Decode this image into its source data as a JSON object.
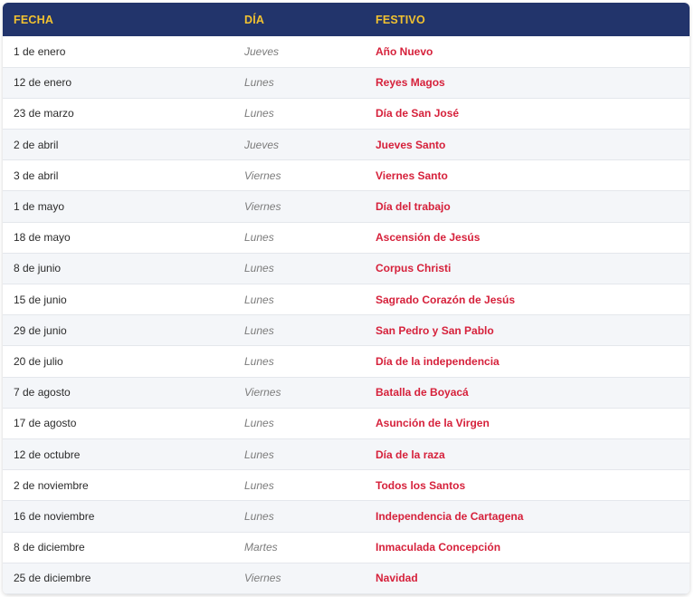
{
  "table": {
    "headers": {
      "fecha": "FECHA",
      "dia": "DÍA",
      "festivo": "FESTIVO"
    },
    "rows": [
      {
        "fecha": "1 de enero",
        "dia": "Jueves",
        "festivo": "Año Nuevo"
      },
      {
        "fecha": "12 de enero",
        "dia": "Lunes",
        "festivo": "Reyes Magos"
      },
      {
        "fecha": "23 de marzo",
        "dia": "Lunes",
        "festivo": "Día de San José"
      },
      {
        "fecha": "2 de abril",
        "dia": "Jueves",
        "festivo": "Jueves Santo"
      },
      {
        "fecha": "3 de abril",
        "dia": "Viernes",
        "festivo": "Viernes Santo"
      },
      {
        "fecha": "1 de mayo",
        "dia": "Viernes",
        "festivo": "Día del trabajo"
      },
      {
        "fecha": "18 de mayo",
        "dia": "Lunes",
        "festivo": "Ascensión de Jesús"
      },
      {
        "fecha": "8 de junio",
        "dia": "Lunes",
        "festivo": "Corpus Christi"
      },
      {
        "fecha": "15 de junio",
        "dia": "Lunes",
        "festivo": "Sagrado Corazón de Jesús"
      },
      {
        "fecha": "29 de junio",
        "dia": "Lunes",
        "festivo": "San Pedro y San Pablo"
      },
      {
        "fecha": "20 de julio",
        "dia": "Lunes",
        "festivo": "Día de la independencia"
      },
      {
        "fecha": "7 de agosto",
        "dia": "Viernes",
        "festivo": "Batalla de Boyacá"
      },
      {
        "fecha": "17 de agosto",
        "dia": "Lunes",
        "festivo": "Asunción de la Virgen"
      },
      {
        "fecha": "12 de octubre",
        "dia": "Lunes",
        "festivo": "Día de la raza"
      },
      {
        "fecha": "2 de noviembre",
        "dia": "Lunes",
        "festivo": "Todos los Santos"
      },
      {
        "fecha": "16 de noviembre",
        "dia": "Lunes",
        "festivo": "Independencia de Cartagena"
      },
      {
        "fecha": "8 de diciembre",
        "dia": "Martes",
        "festivo": "Inmaculada Concepción"
      },
      {
        "fecha": "25 de diciembre",
        "dia": "Viernes",
        "festivo": "Navidad"
      }
    ]
  },
  "colors": {
    "header_bg": "#22346b",
    "header_text": "#f2c230",
    "holiday_text": "#d6213b"
  }
}
